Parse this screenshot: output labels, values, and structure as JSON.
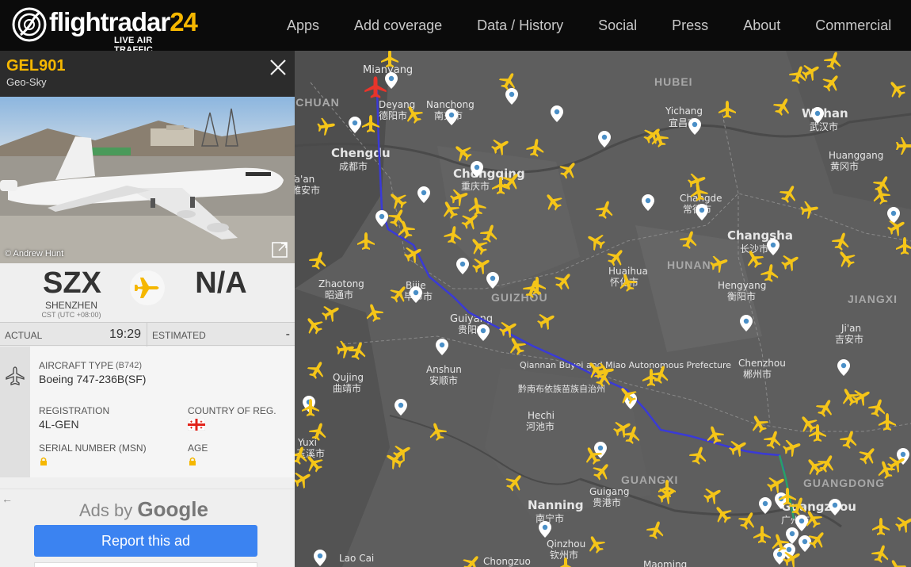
{
  "header": {
    "logo_prefix": "flightradar",
    "logo_number": "24",
    "tagline": "LIVE AIR TRAFFIC",
    "nav": [
      "Apps",
      "Add coverage",
      "Data / History",
      "Social",
      "Press",
      "About",
      "Commercial"
    ]
  },
  "flight": {
    "callsign": "GEL901",
    "airline": "Geo-Sky",
    "photo_credit": "© Andrew Hunt",
    "origin": {
      "code": "SZX",
      "city": "SHENZHEN",
      "timezone": "CST (UTC +08:00)"
    },
    "destination": {
      "code": "N/A"
    },
    "times": {
      "actual_label": "ACTUAL",
      "actual_value": "19:29",
      "estimated_label": "ESTIMATED",
      "estimated_value": "-"
    },
    "details": {
      "aircraft_type_label": "AIRCRAFT TYPE",
      "aircraft_type_code": "(B742)",
      "aircraft_type_value": "Boeing 747-236B(SF)",
      "registration_label": "REGISTRATION",
      "registration_value": "4L-GEN",
      "country_label": "COUNTRY OF REG.",
      "serial_label": "SERIAL NUMBER (MSN)",
      "age_label": "AGE"
    }
  },
  "ads": {
    "back": "←",
    "ads_by": "Ads by",
    "google": "Google",
    "report": "Report this ad"
  },
  "map": {
    "regions": [
      "HUBEI",
      "HUNAN",
      "GUIZHOU",
      "GUANGXI",
      "GUANGDONG",
      "JIANGXI",
      "SICHUAN"
    ],
    "cities": [
      {
        "en": "Mianyang",
        "zh": ""
      },
      {
        "en": "Deyang",
        "zh": "德阳市"
      },
      {
        "en": "Nanchong",
        "zh": "南充市"
      },
      {
        "en": "Chengdu",
        "zh": "成都市"
      },
      {
        "en": "Ya'an",
        "zh": "雅安市"
      },
      {
        "en": "Chongqing",
        "zh": "重庆市"
      },
      {
        "en": "Yichang",
        "zh": "宜昌市"
      },
      {
        "en": "Wuhan",
        "zh": "武汉市"
      },
      {
        "en": "Huanggang",
        "zh": "黄冈市"
      },
      {
        "en": "Changde",
        "zh": "常德市"
      },
      {
        "en": "Changsha",
        "zh": "长沙市"
      },
      {
        "en": "Huaihua",
        "zh": "怀化市"
      },
      {
        "en": "Zhaotong",
        "zh": "昭通市"
      },
      {
        "en": "Bijie",
        "zh": "毕节市"
      },
      {
        "en": "Guiyang",
        "zh": "贵阳市"
      },
      {
        "en": "Qiannan Buyei and Miao Autonomous Prefecture",
        "zh": "黔南布依族苗族自治州"
      },
      {
        "en": "Hengyang",
        "zh": "衡阳市"
      },
      {
        "en": "Ji'an",
        "zh": "吉安市"
      },
      {
        "en": "Anshun",
        "zh": "安顺市"
      },
      {
        "en": "Chenzhou",
        "zh": "郴州市"
      },
      {
        "en": "Qujing",
        "zh": "曲靖市"
      },
      {
        "en": "Hechi",
        "zh": "河池市"
      },
      {
        "en": "Yuxi",
        "zh": "玉溪市"
      },
      {
        "en": "Guigang",
        "zh": "贵港市"
      },
      {
        "en": "Nanning",
        "zh": "南宁市"
      },
      {
        "en": "Guangzhou",
        "zh": "广州市"
      },
      {
        "en": "Qinzhou",
        "zh": "钦州市"
      },
      {
        "en": "Chongzuo",
        "zh": ""
      },
      {
        "en": "Maoming",
        "zh": ""
      },
      {
        "en": "Lao Cai",
        "zh": ""
      }
    ],
    "plane_color": "#f5c518",
    "selected_plane_color": "#e8342a",
    "track_color": "#3a3ad6"
  }
}
